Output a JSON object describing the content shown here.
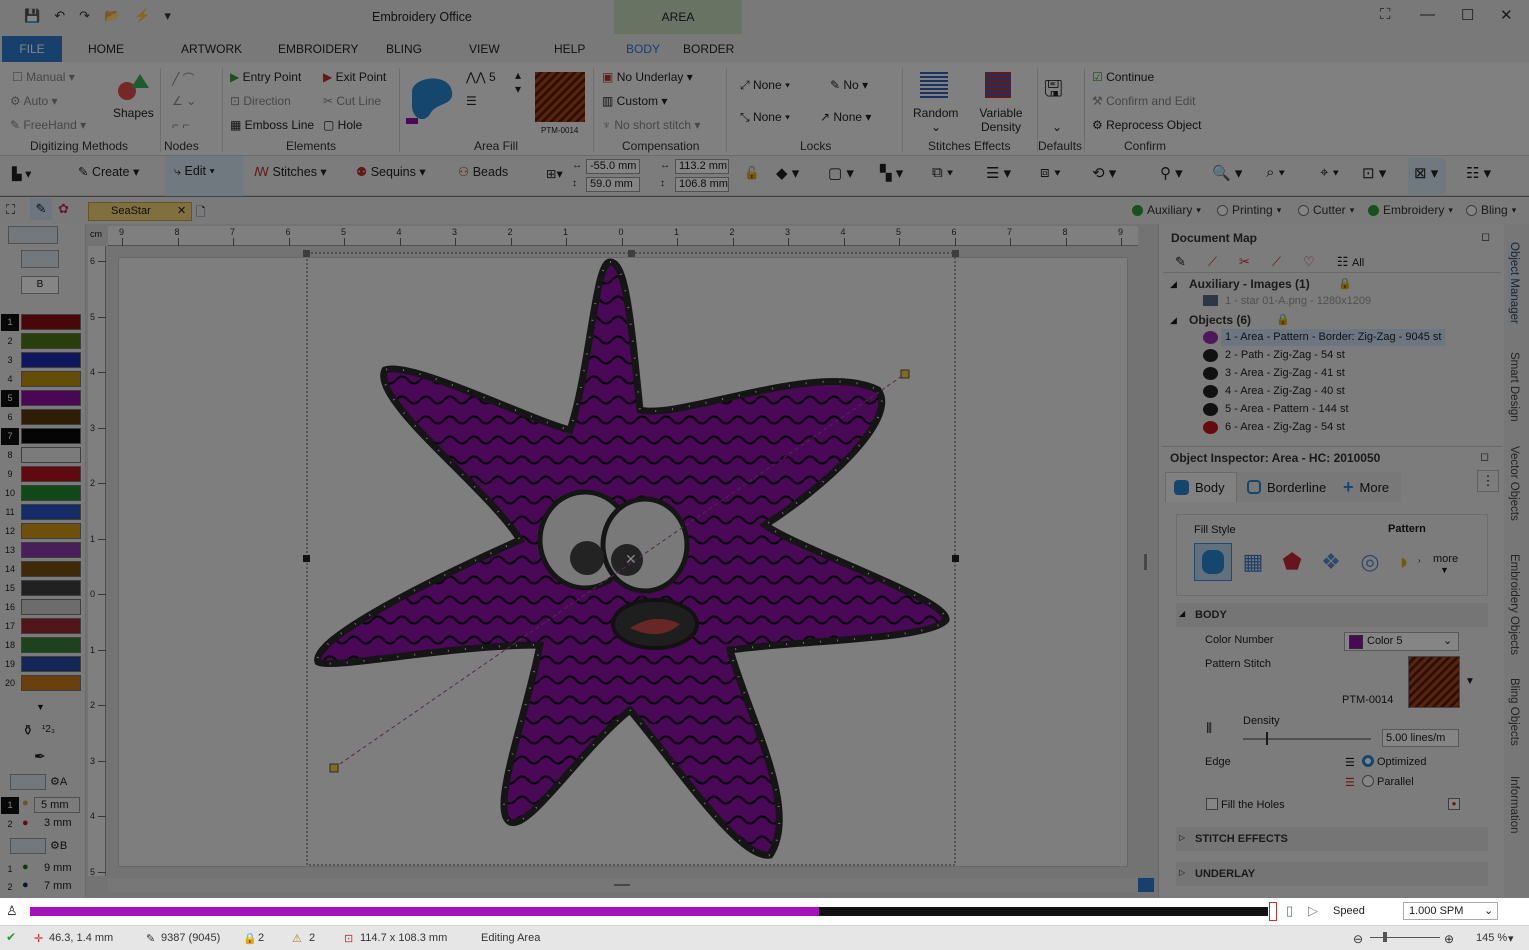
{
  "titlebar": {
    "app_title": "Embroidery Office",
    "context_tab": "AREA",
    "minimize": "—",
    "maximize": "☐",
    "close": "✕",
    "restore": "⛶"
  },
  "menu": {
    "file": "FILE",
    "tabs": [
      "HOME",
      "ARTWORK",
      "EMBROIDERY",
      "BLING",
      "VIEW",
      "HELP",
      "BODY",
      "BORDER"
    ],
    "active_tab": "BODY"
  },
  "ribbon": {
    "digitizing": {
      "title": "Digitizing Methods",
      "manual": "Manual",
      "auto": "Auto",
      "freehand": "FreeHand",
      "shapes": "Shapes"
    },
    "nodes": {
      "title": "Nodes"
    },
    "elements": {
      "title": "Elements",
      "entry_point": "Entry Point",
      "exit_point": "Exit Point",
      "direction": "Direction",
      "cut_line": "Cut Line",
      "emboss_line": "Emboss Line",
      "hole": "Hole"
    },
    "area_fill": {
      "title": "Area Fill",
      "count": "5",
      "pattern": "PTM-0014"
    },
    "compensation": {
      "title": "Compensation",
      "underlay": "No Underlay",
      "custom": "Custom",
      "short_stitch": "No short stitch"
    },
    "locks": {
      "title": "Locks",
      "a1": "None",
      "a2": "No",
      "b1": "None",
      "b2": "None"
    },
    "stitch_effects": {
      "title": "Stitches Effects",
      "random": "Random",
      "variable_density": "Variable Density"
    },
    "defaults": {
      "title": "Defaults"
    },
    "confirm": {
      "title": "Confirm",
      "continue": "Continue",
      "confirm_edit": "Confirm and Edit",
      "reprocess": "Reprocess Object"
    }
  },
  "toolbar": {
    "create": "Create",
    "edit": "Edit",
    "stitches": "Stitches",
    "sequins": "Sequins",
    "beads": "Beads",
    "x": "-55.0 mm",
    "y": "59.0 mm",
    "w": "113.2 mm",
    "h": "106.8 mm"
  },
  "document": {
    "tab": "SeaStar",
    "modes": [
      {
        "label": "Auxiliary",
        "on": true
      },
      {
        "label": "Printing",
        "on": false
      },
      {
        "label": "Cutter",
        "on": false
      },
      {
        "label": "Embroidery",
        "on": true
      },
      {
        "label": "Bling",
        "on": false
      }
    ]
  },
  "palette": {
    "colors": [
      {
        "n": "1",
        "c": "#8d0f14",
        "sel": true
      },
      {
        "n": "2",
        "c": "#4d7a17",
        "sel": false
      },
      {
        "n": "3",
        "c": "#1f2fb3",
        "sel": false
      },
      {
        "n": "4",
        "c": "#c4950f",
        "sel": false
      },
      {
        "n": "5",
        "c": "#8c0fa6",
        "sel": true
      },
      {
        "n": "6",
        "c": "#5a3a0a",
        "sel": false
      },
      {
        "n": "7",
        "c": "#0a0a0a",
        "sel": true
      },
      {
        "n": "8",
        "c": "#ececec",
        "sel": false
      },
      {
        "n": "9",
        "c": "#b8121c",
        "sel": false
      },
      {
        "n": "10",
        "c": "#1f8a2d",
        "sel": false
      },
      {
        "n": "11",
        "c": "#2a55c9",
        "sel": false
      },
      {
        "n": "12",
        "c": "#d49a14",
        "sel": false
      },
      {
        "n": "13",
        "c": "#8a3aae",
        "sel": false
      },
      {
        "n": "14",
        "c": "#7a4f10",
        "sel": false
      },
      {
        "n": "15",
        "c": "#404040",
        "sel": false
      },
      {
        "n": "16",
        "c": "#cfcfcf",
        "sel": false
      },
      {
        "n": "17",
        "c": "#9c2a33",
        "sel": false
      },
      {
        "n": "18",
        "c": "#3b7f34",
        "sel": false
      },
      {
        "n": "19",
        "c": "#2a4aa8",
        "sel": false
      },
      {
        "n": "20",
        "c": "#cf7a1e",
        "sel": false
      }
    ],
    "ab_label_a": "A",
    "ab_label_b": "B",
    "a1": "5 mm",
    "a2": "3 mm",
    "b1": "9 mm",
    "b2": "7 mm",
    "counter": "¹2₃"
  },
  "ruler": {
    "unit": "cm",
    "h_ticks": [
      "9",
      "8",
      "7",
      "6",
      "5",
      "4",
      "3",
      "2",
      "1",
      "0",
      "1",
      "2",
      "3",
      "4",
      "5",
      "6",
      "7",
      "8",
      "9"
    ],
    "v_ticks": [
      "6",
      "5",
      "4",
      "3",
      "2",
      "1",
      "0",
      "1",
      "2",
      "3",
      "4",
      "5"
    ]
  },
  "document_map": {
    "title": "Document Map",
    "all_label": "All",
    "aux_group": "Auxiliary - Images (1)",
    "aux_item": "1 - star 01-A.png - 1280x1209",
    "obj_group": "Objects (6)",
    "objects": [
      {
        "label": "1 - Area - Pattern - Border: Zig-Zag - 9045 st",
        "color": "#9a2cb0"
      },
      {
        "label": "2 - Path - Zig-Zag - 54 st",
        "color": "#222222"
      },
      {
        "label": "3 - Area - Zig-Zag - 41 st",
        "color": "#222222"
      },
      {
        "label": "4 - Area - Zig-Zag - 40 st",
        "color": "#222222"
      },
      {
        "label": "5 - Area - Pattern - 144 st",
        "color": "#222222"
      },
      {
        "label": "6 - Area - Zig-Zag - 54 st",
        "color": "#c0161e"
      }
    ]
  },
  "inspector": {
    "title": "Object Inspector: Area - HC: 2010050",
    "tabs": [
      "Body",
      "Borderline",
      "More"
    ],
    "fill_style": "Fill Style",
    "fill_value": "Pattern",
    "more": "more",
    "section_body": "BODY",
    "color_number": "Color Number",
    "color_value": "Color 5",
    "pattern_stitch": "Pattern Stitch",
    "pattern_code": "PTM-0014",
    "density": "Density",
    "density_value": "5.00 lines/m",
    "density_level": 0.18,
    "edge": "Edge",
    "edge_opt1": "Optimized",
    "edge_opt2": "Parallel",
    "fill_holes": "Fill the Holes",
    "section_stitch_effects": "STITCH EFFECTS",
    "section_underlay": "UNDERLAY"
  },
  "side_tabs": [
    "Object Manager",
    "Smart Design",
    "Vector Objects",
    "Embroidery Objects",
    "Bling Objects",
    "Information"
  ],
  "stitch_bar": {
    "progress": 0.637,
    "speed_label": "Speed",
    "speed_value": "1.000 SPM"
  },
  "status": {
    "position": "46.3, 1.4 mm",
    "stitches": "9387 (9045)",
    "locks": "2",
    "objects": "2",
    "size": "114.7 x 108.3 mm",
    "mode": "Editing Area",
    "zoom": "145 %"
  },
  "colors": {
    "accent": "#2f7bd0",
    "star_fill": "#8c12a8",
    "selection": "#cde3f7"
  }
}
